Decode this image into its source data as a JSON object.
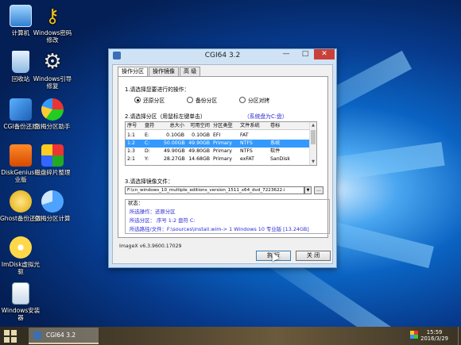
{
  "desktop": {
    "icons": [
      {
        "label": "计算机",
        "icon": "computer-icon"
      },
      {
        "label": "Windows密码修改",
        "icon": "key-icon"
      },
      {
        "label": "回收站",
        "icon": "recycle-bin-icon"
      },
      {
        "label": "Windows引导修复",
        "icon": "gear-icon"
      },
      {
        "label": "CGI备份还原",
        "icon": "cgi-icon"
      },
      {
        "label": "傲梅分区助手",
        "icon": "partition-assistant-icon"
      },
      {
        "label": "DiskGenius专业版",
        "icon": "diskgenius-icon"
      },
      {
        "label": "磁盘碎片整理",
        "icon": "defrag-icon"
      },
      {
        "label": "Ghost备份还原",
        "icon": "ghost-icon"
      },
      {
        "label": "傲梅分区计算",
        "icon": "pie-icon"
      },
      {
        "label": "ImDisk虚拟光驱",
        "icon": "imdisk-icon"
      },
      {
        "label": "Windows安装器",
        "icon": "installer-icon"
      }
    ]
  },
  "window": {
    "title": "CGI64  3.2",
    "controls": {
      "minimize": "—",
      "maximize": "□",
      "close": "✕"
    },
    "tabs": [
      "操作分区",
      "操作镜像",
      "高 级"
    ],
    "section1_label": "1.请选择您要进行的操作：",
    "radios": [
      {
        "label": "还原分区",
        "checked": true
      },
      {
        "label": "备份分区",
        "checked": false
      },
      {
        "label": "分区对拷",
        "checked": false
      }
    ],
    "section2_label": "2.请选择分区（用鼠标左键单击）",
    "system_disk_note": "（系统盘为C:盘）",
    "table": {
      "headers": [
        "序号",
        "盘符",
        "总大小",
        "可用空间",
        "分区类型",
        "文件系统",
        "卷标"
      ],
      "rows": [
        [
          "1:1",
          "E:",
          "0.10GB",
          "0.10GB",
          "EFI",
          "FAT",
          ""
        ],
        [
          "1:2",
          "C:",
          "50.00GB",
          "49.90GB",
          "Primary",
          "NTFS",
          "系统"
        ],
        [
          "1:3",
          "D:",
          "49.90GB",
          "49.80GB",
          "Primary",
          "NTFS",
          "软件"
        ],
        [
          "2:1",
          "Y:",
          "28.27GB",
          "14.68GB",
          "Primary",
          "exFAT",
          "SanDisk"
        ]
      ],
      "selected_row": 1
    },
    "section3_label": "3.请选择镜像文件：",
    "image_path": "F:\\cn_windows_10_multiple_editions_version_1511_x64_dvd_7223622.i",
    "browse_label": "...",
    "status": {
      "label": "状态：",
      "operation": "所选操作：还原分区",
      "partition": "所选分区：  序号 1:2        盘符 C:",
      "path": "所选路径/文件：F:\\sources\\install.wim-> 1  Windows 10 专业版 [13.24GB]"
    },
    "footer": "ImageX v6.3.9600.17029",
    "execute_label": "执 行",
    "close_label": "关 闭"
  },
  "taskbar": {
    "task_label": "CGI64  3.2",
    "time": "15:59",
    "date": "2016/3/29"
  }
}
